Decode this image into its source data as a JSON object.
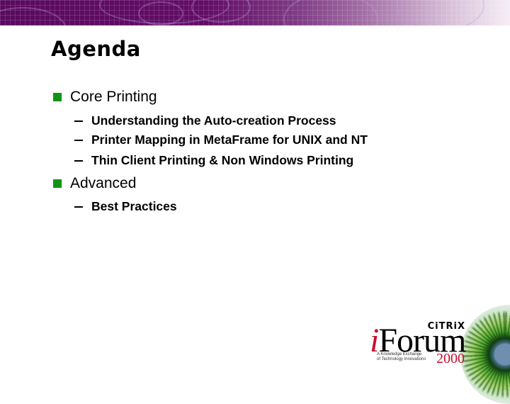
{
  "slide": {
    "title": "Agenda",
    "items": [
      {
        "label": "Core Printing",
        "subitems": [
          "Understanding the Auto-creation Process",
          "Printer Mapping in MetaFrame for UNIX and NT",
          "Thin Client Printing & Non Windows Printing"
        ]
      },
      {
        "label": "Advanced",
        "subitems": [
          "Best Practices"
        ]
      }
    ]
  },
  "logo": {
    "brand": "CiTRiX",
    "product_prefix": "i",
    "product_rest": "Forum",
    "tagline_line1": "A Knowledge Exchange",
    "tagline_line2": "of Technology Innovations",
    "year": "2000"
  },
  "colors": {
    "bullet": "#139313",
    "header": "#620c66",
    "logo_accent": "#c8102e"
  }
}
